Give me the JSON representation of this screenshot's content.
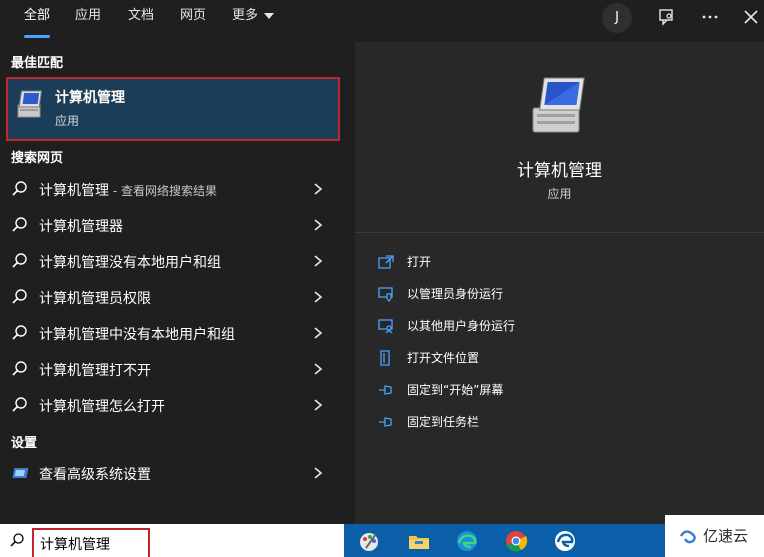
{
  "tabs": [
    {
      "label": "全部",
      "active": true
    },
    {
      "label": "应用",
      "active": false
    },
    {
      "label": "文档",
      "active": false
    },
    {
      "label": "网页",
      "active": false
    },
    {
      "label": "更多",
      "active": false
    }
  ],
  "header": {
    "avatar": "J",
    "feedback_icon": "feedback-icon",
    "more_icon": "ellipsis-icon",
    "close_icon": "close-icon"
  },
  "left": {
    "best_match_label": "最佳匹配",
    "best_match": {
      "title": "计算机管理",
      "subtitle": "应用"
    },
    "web_label": "搜索网页",
    "web_results": [
      {
        "text": "计算机管理",
        "suffix": " - 查看网络搜索结果"
      },
      {
        "text": "计算机管理器",
        "suffix": ""
      },
      {
        "text": "计算机管理没有本地用户和组",
        "suffix": ""
      },
      {
        "text": "计算机管理员权限",
        "suffix": ""
      },
      {
        "text": "计算机管理中没有本地用户和组",
        "suffix": ""
      },
      {
        "text": "计算机管理打不开",
        "suffix": ""
      },
      {
        "text": "计算机管理怎么打开",
        "suffix": ""
      }
    ],
    "settings_label": "设置",
    "settings_results": [
      {
        "text": "查看高级系统设置"
      }
    ]
  },
  "right": {
    "title": "计算机管理",
    "subtitle": "应用",
    "actions": [
      {
        "label": "打开",
        "icon": "open-icon"
      },
      {
        "label": "以管理员身份运行",
        "icon": "shield-icon"
      },
      {
        "label": "以其他用户身份运行",
        "icon": "user-icon"
      },
      {
        "label": "打开文件位置",
        "icon": "folder-icon"
      },
      {
        "label": "固定到“开始”屏幕",
        "icon": "pin-icon"
      },
      {
        "label": "固定到任务栏",
        "icon": "pin-icon"
      }
    ]
  },
  "search": {
    "value": "计算机管理"
  },
  "taskbar": {
    "icons": [
      "paint-icon",
      "file-explorer-icon",
      "edge-icon",
      "chrome-icon",
      "edge-dev-icon"
    ]
  },
  "watermark": {
    "text": "亿速云"
  },
  "colors": {
    "accent": "#4aa3ff",
    "selected_bg": "#1c3d57",
    "highlight_border": "#c0272d",
    "taskbar": "#0b5fa8"
  }
}
